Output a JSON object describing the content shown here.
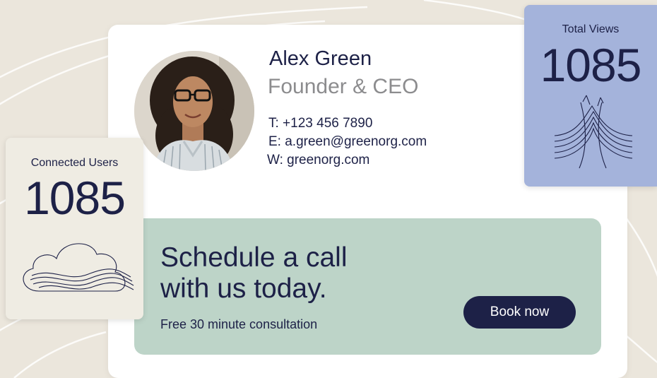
{
  "profile": {
    "name": "Alex Green",
    "role": "Founder & CEO",
    "phone": "T: +123 456 7890",
    "email": "E: a.green@greenorg.com",
    "website": "W: greenorg.com"
  },
  "cta": {
    "heading_line1": "Schedule a call",
    "heading_line2": "with us today.",
    "subtext": "Free 30 minute consultation",
    "button_label": "Book now"
  },
  "stats": {
    "connected_users": {
      "label": "Connected Users",
      "value": "1085",
      "icon": "cloud-waves-icon"
    },
    "total_views": {
      "label": "Total Views",
      "value": "1085",
      "icon": "flow-lines-icon"
    }
  },
  "colors": {
    "background": "#ebe6dc",
    "card": "#ffffff",
    "navy": "#1d2147",
    "muted_gray": "#8c8c8e",
    "cta_green": "#bdd4c8",
    "views_tile": "#a4b3db",
    "users_tile": "#efece3"
  }
}
